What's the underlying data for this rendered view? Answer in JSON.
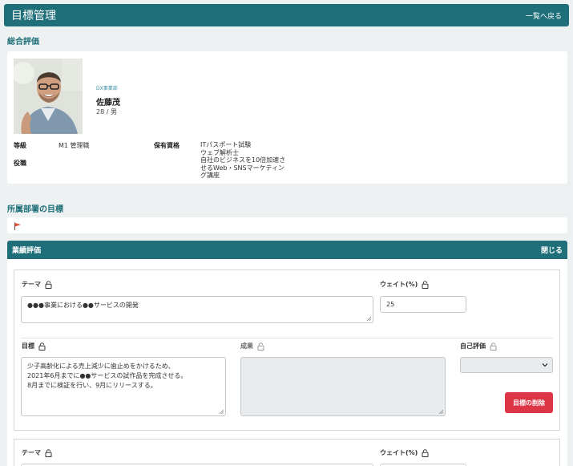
{
  "header": {
    "title": "目標管理",
    "back_label": "一覧へ戻る"
  },
  "overall": {
    "section_title": "総合評価",
    "profile": {
      "department": "DX事業部",
      "name": "佐藤茂",
      "age_gender": "28 / 男"
    },
    "grade_label": "等級",
    "grade_value": "M1 管理職",
    "position_label": "役職",
    "qualifications_label": "保有資格",
    "qualifications": [
      "ITパスポート試験",
      "ウェブ解析士",
      "自社のビジネスを10倍加速さ",
      "せるWeb・SNSマーケティン",
      "グ講座"
    ]
  },
  "dept_goals": {
    "section_title": "所属部署の目標"
  },
  "performance": {
    "section_title": "業績評価",
    "close_label": "閉じる",
    "theme_label": "テーマ",
    "weight_label": "ウェイト(%)",
    "goal_label": "目標",
    "result_label": "成果",
    "self_eval_label": "自己評価",
    "delete_label": "目標の削除",
    "goal1": {
      "theme_value": "●●●事業における●●サービスの開発",
      "weight_value": "25",
      "goal_lines": [
        "少子高齢化による売上減少に歯止めをかけるため、",
        "2021年6月までに●●サービスの試作品を完成させる。",
        "8月までに検証を行い、9月にリリースする。"
      ],
      "result_value": "",
      "self_eval_value": ""
    }
  },
  "colors": {
    "brand": "#1e6f79",
    "danger": "#dc3545",
    "flag": "#e0533a"
  }
}
